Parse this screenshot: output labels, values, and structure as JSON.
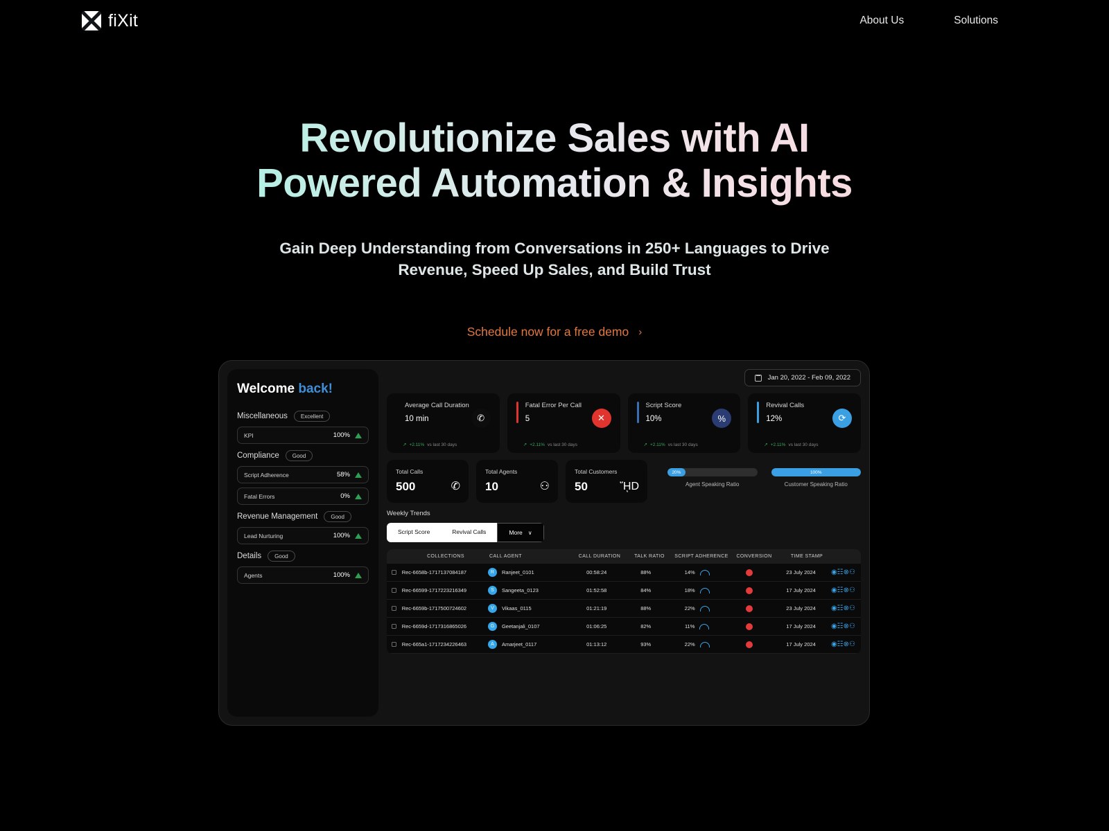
{
  "nav": {
    "brand": "fiXit",
    "logo_icon": "x-mark-logo-icon",
    "links": [
      {
        "label": "About Us"
      },
      {
        "label": "Solutions"
      }
    ]
  },
  "hero": {
    "headline": "Revolutionize Sales with AI Powered Automation & Insights",
    "subheadline": "Gain Deep Understanding from Conversations in 250+ Languages to Drive Revenue, Speed Up Sales, and Build Trust",
    "cta_label": "Schedule now for a free demo",
    "cta_chevron": "›",
    "gradient_start": "#b2efe3",
    "gradient_end": "#f7dbe0",
    "cta_color": "#e2773f"
  },
  "dashboard": {
    "sidebar": {
      "greeting_primary": "Welcome",
      "greeting_accent": " back!",
      "accent_color": "#3f8fd8",
      "groups": [
        {
          "title": "Miscellaneous",
          "badge": "Excellent",
          "rows": [
            {
              "name": "KPI",
              "value": "100%",
              "trend": "up"
            }
          ]
        },
        {
          "title": "Compliance",
          "badge": "Good",
          "rows": [
            {
              "name": "Script Adherence",
              "value": "58%",
              "trend": "up"
            },
            {
              "name": "Fatal Errors",
              "value": "0%",
              "trend": "up"
            }
          ]
        },
        {
          "title": "Revenue Management",
          "badge": "Good",
          "rows": [
            {
              "name": "Lead Nurturing",
              "value": "100%",
              "trend": "up"
            }
          ]
        },
        {
          "title": "Details",
          "badge": "Good",
          "rows": [
            {
              "name": "Agents",
              "value": "100%",
              "trend": "up"
            }
          ]
        }
      ]
    },
    "date_range": {
      "icon": "calendar-icon",
      "value": "Jan 20, 2022 - Feb 09, 2022"
    },
    "kpi_cards": [
      {
        "label": "Average Call Duration",
        "value": "10 min",
        "delta": "+2.11%",
        "delta_note": "vs last 30 days",
        "icon": "phone-icon",
        "icon_glyph": "✆",
        "icon_bg": "#0d0d0d",
        "accent_color": "#0a0a0a"
      },
      {
        "label": "Fatal Error Per Call",
        "value": "5",
        "delta": "+2.11%",
        "delta_note": "vs last 30 days",
        "icon": "error-x-icon",
        "icon_glyph": "✕",
        "icon_bg": "#e0342f",
        "accent_color": "#e0342f"
      },
      {
        "label": "Script Score",
        "value": "10%",
        "delta": "+2.11%",
        "delta_note": "vs last 30 days",
        "icon": "percent-icon",
        "icon_glyph": "%",
        "icon_bg": "#2b3c73",
        "accent_color": "#3b6fb5"
      },
      {
        "label": "Revival Calls",
        "value": "12%",
        "delta": "+2.11%",
        "delta_note": "vs last 30 days",
        "icon": "refresh-icon",
        "icon_glyph": "⟳",
        "icon_bg": "#3ba0e3",
        "accent_color": "#3ba0e3"
      }
    ],
    "totals": [
      {
        "label": "Total Calls",
        "value": "500",
        "icon": "phone-icon",
        "icon_glyph": "✆"
      },
      {
        "label": "Total Agents",
        "value": "10",
        "icon": "headset-icon",
        "icon_glyph": "⚇"
      },
      {
        "label": "Total Customers",
        "value": "50",
        "icon": "person-icon",
        "icon_glyph": "ᾜD"
      }
    ],
    "speaking_ratios": [
      {
        "caption": "Agent Speaking Ratio",
        "value": "20%",
        "percent": 20
      },
      {
        "caption": "Customer Speaking Ratio",
        "value": "100%",
        "percent": 100
      }
    ],
    "weekly_trends": {
      "title": "Weekly Trends",
      "tabs": [
        {
          "label": "Script Score",
          "active": true
        },
        {
          "label": "Revival Calls",
          "active": true
        },
        {
          "label": "More",
          "active": false,
          "chevron": "∨"
        }
      ]
    },
    "table": {
      "columns": [
        "COLLECTIONS",
        "CALL AGENT",
        "CALL DURATION",
        "TALK RATIO",
        "SCRIPT ADHERENCE",
        "CONVERSION",
        "TIME STAMP"
      ],
      "row_actions": [
        {
          "icon": "eye-icon",
          "glyph": "◉"
        },
        {
          "icon": "document-icon",
          "glyph": "☷"
        },
        {
          "icon": "circled-x-icon",
          "glyph": "⊗"
        },
        {
          "icon": "chat-icon",
          "glyph": "⚇"
        }
      ],
      "rows": [
        {
          "collection": "Rec-6658b-1717137084187",
          "agent": "Ranjeet_0101",
          "agent_initial": "R",
          "duration": "00:58:24",
          "talk_ratio": "88%",
          "script_adherence": "14%",
          "conversion": "red",
          "timestamp": "23 July 2024"
        },
        {
          "collection": "Rec-66599-1717223216349",
          "agent": "Sangeeta_0123",
          "agent_initial": "S",
          "duration": "01:52:58",
          "talk_ratio": "84%",
          "script_adherence": "18%",
          "conversion": "red",
          "timestamp": "17 July 2024"
        },
        {
          "collection": "Rec-6659b-1717500724602",
          "agent": "Vikaas_0115",
          "agent_initial": "V",
          "duration": "01:21:19",
          "talk_ratio": "88%",
          "script_adherence": "22%",
          "conversion": "red",
          "timestamp": "23 July 2024"
        },
        {
          "collection": "Rec-6659d-1717316865026",
          "agent": "Geetanjali_0107",
          "agent_initial": "G",
          "duration": "01:06:25",
          "talk_ratio": "82%",
          "script_adherence": "11%",
          "conversion": "red",
          "timestamp": "17 July 2024"
        },
        {
          "collection": "Rec-665a1-1717234226463",
          "agent": "Amarjeet_0117",
          "agent_initial": "A",
          "duration": "01:13:12",
          "talk_ratio": "93%",
          "script_adherence": "22%",
          "conversion": "red",
          "timestamp": "17 July 2024"
        }
      ]
    }
  }
}
